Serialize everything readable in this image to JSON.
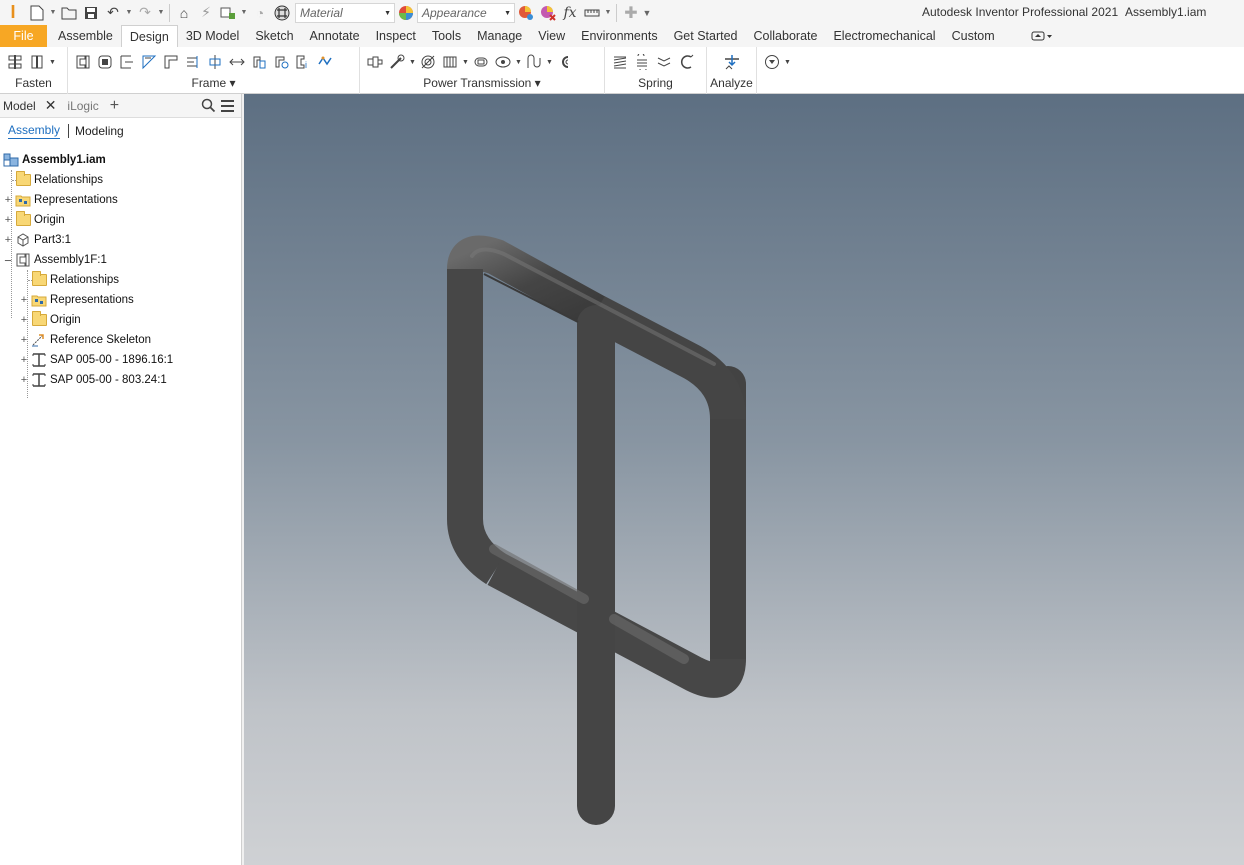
{
  "quick_access": {
    "material_placeholder": "Material",
    "appearance_placeholder": "Appearance",
    "fx_label": "fx"
  },
  "title": {
    "app": "Autodesk Inventor Professional 2021",
    "document": "Assembly1.iam"
  },
  "ribbon_tabs": [
    {
      "label": "File"
    },
    {
      "label": "Assemble"
    },
    {
      "label": "Design",
      "active": true
    },
    {
      "label": "3D Model"
    },
    {
      "label": "Sketch"
    },
    {
      "label": "Annotate"
    },
    {
      "label": "Inspect"
    },
    {
      "label": "Tools"
    },
    {
      "label": "Manage"
    },
    {
      "label": "View"
    },
    {
      "label": "Environments"
    },
    {
      "label": "Get Started"
    },
    {
      "label": "Collaborate"
    },
    {
      "label": "Electromechanical"
    },
    {
      "label": "Custom"
    }
  ],
  "ribbon_groups": {
    "fasten": "Fasten",
    "frame": "Frame ▾",
    "power_transmission": "Power Transmission ▾",
    "spring": "Spring",
    "analyze": "Analyze"
  },
  "browser": {
    "tabs": {
      "model": "Model",
      "ilogic": "iLogic"
    },
    "subtabs": {
      "assembly": "Assembly",
      "modeling": "Modeling"
    },
    "tree": [
      {
        "label": "Assembly1.iam"
      },
      {
        "label": "Relationships"
      },
      {
        "label": "Representations"
      },
      {
        "label": "Origin"
      },
      {
        "label": "Part3:1"
      },
      {
        "label": "Assembly1F:1"
      },
      {
        "label": "Relationships"
      },
      {
        "label": "Representations"
      },
      {
        "label": "Origin"
      },
      {
        "label": "Reference Skeleton"
      },
      {
        "label": "SAP 005-00 - 1896.16:1"
      },
      {
        "label": "SAP 005-00 - 803.24:1"
      }
    ]
  },
  "colors": {
    "file_tab": "#f7a724",
    "accent": "#1e6fc0",
    "pipe": "#454545",
    "viewport_top": "#5d6f82",
    "viewport_bottom": "#cfd1d4"
  }
}
